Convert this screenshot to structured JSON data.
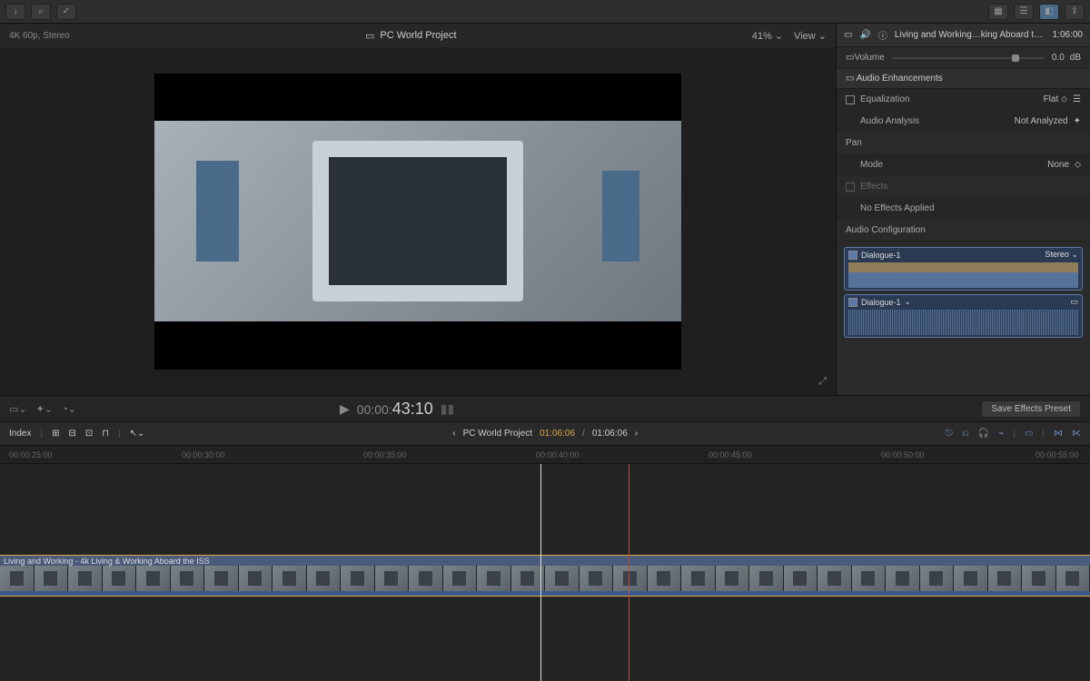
{
  "topbar": {
    "import_icon": "↓",
    "key_icon": "⌕",
    "check_icon": "✓"
  },
  "viewer": {
    "format": "4K 60p, Stereo",
    "project_icon": "🖭",
    "project_name": "PC World Project",
    "zoom": "41%",
    "view_label": "View"
  },
  "inspector": {
    "clip_name": "Living and Working…king Aboard the ISS",
    "clip_duration": "1:06:00",
    "volume_label": "Volume",
    "volume_value": "0.0",
    "volume_unit": "dB",
    "enhancements_label": "Audio Enhancements",
    "equalization_label": "Equalization",
    "equalization_value": "Flat",
    "analysis_label": "Audio Analysis",
    "analysis_value": "Not Analyzed",
    "pan_label": "Pan",
    "mode_label": "Mode",
    "mode_value": "None",
    "effects_label": "Effects",
    "no_effects": "No Effects Applied",
    "audio_config_label": "Audio Configuration",
    "channels": [
      {
        "name": "Dialogue-1",
        "type": "Stereo"
      },
      {
        "name": "Dialogue-1",
        "type": ""
      }
    ],
    "save_preset": "Save Effects Preset"
  },
  "transport": {
    "tc_prefix": "00:00:",
    "tc_frames": "43:10"
  },
  "timeline_toolbar": {
    "index_label": "Index",
    "project_name": "PC World Project",
    "current_tc": "01:06:06",
    "total_tc": "01:06:06"
  },
  "ruler": {
    "marks": [
      "00:00:25:00",
      "00:00:30:00",
      "00:00:35:00",
      "00:00:40:00",
      "00:00:45:00",
      "00:00:50:00",
      "00:00:55:00"
    ]
  },
  "clip": {
    "title": "Living and Working - 4k Living & Working Aboard the ISS"
  }
}
